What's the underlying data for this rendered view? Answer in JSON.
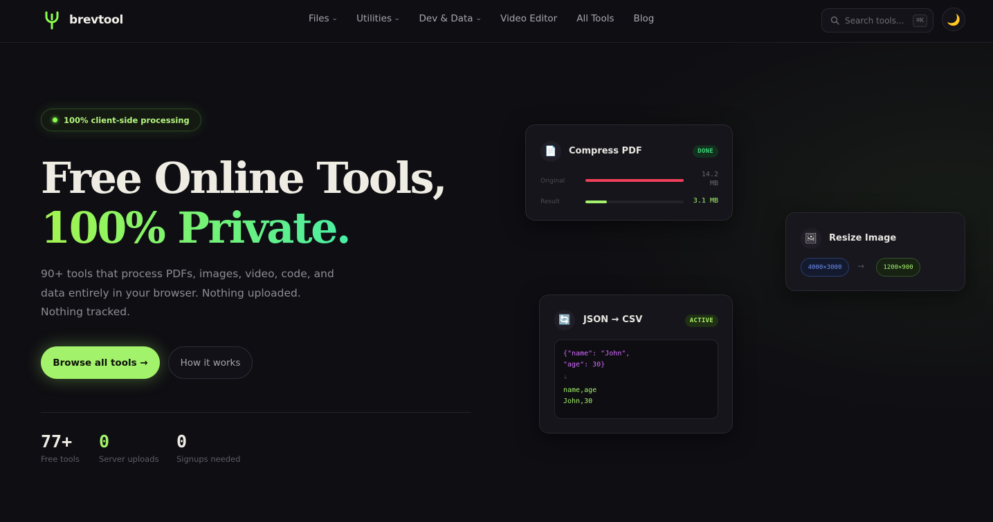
{
  "brand": {
    "name": "brevtool"
  },
  "nav": {
    "links": [
      {
        "label": "Files",
        "dropdown": true
      },
      {
        "label": "Utilities",
        "dropdown": true
      },
      {
        "label": "Dev & Data",
        "dropdown": true
      },
      {
        "label": "Video Editor",
        "dropdown": false
      },
      {
        "label": "All Tools",
        "dropdown": false
      },
      {
        "label": "Blog",
        "dropdown": false
      }
    ],
    "search": {
      "placeholder": "Search tools...",
      "shortcut": "⌘K"
    },
    "theme_icon": "moon-icon"
  },
  "hero": {
    "pill": "100% client-side processing",
    "title_line1": "Free Online Tools,",
    "title_line2": "100% Private.",
    "subtitle": "90+ tools that process PDFs, images, video, code, and data entirely in your browser. Nothing uploaded. Nothing tracked.",
    "primary_button": "Browse all tools →",
    "secondary_button": "How it works",
    "stats": [
      {
        "value": "77+",
        "label": "Free tools"
      },
      {
        "value": "0",
        "label": "Server uploads"
      },
      {
        "value": "0",
        "label": "Signups needed"
      }
    ]
  },
  "cards": {
    "compress": {
      "title": "Compress PDF",
      "icon": "document-icon",
      "badge": "DONE",
      "original_label": "Original",
      "original_value": "14.2 MB",
      "original_fraction": 1.0,
      "result_label": "Result",
      "result_value": "3.1 MB",
      "result_fraction": 0.22,
      "colors": {
        "original": "#f0405a",
        "result": "#a3f26b"
      }
    },
    "resize": {
      "title": "Resize Image",
      "icon": "image-icon",
      "from": "4000×3000",
      "arrow": "→",
      "to": "1200×900"
    },
    "json": {
      "title": "JSON → CSV",
      "icon": "convert-icon",
      "badge": "ACTIVE",
      "code_line1": "{\"name\": \"John\",",
      "code_line2": "\"age\": 30}",
      "code_arrow": "↓",
      "out_line1": "name,age",
      "out_line2": "John,30"
    }
  }
}
